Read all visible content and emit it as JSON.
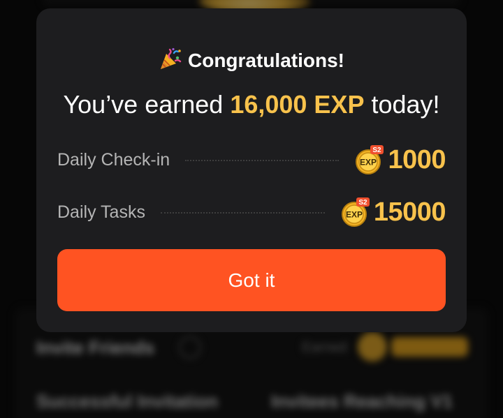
{
  "modal": {
    "title": "Congratulations!",
    "title_icon": "party-popper-icon",
    "earned_prefix": "You’ve earned ",
    "earned_amount": "16,000 EXP",
    "earned_suffix": " today!",
    "rows": [
      {
        "label": "Daily Check-in",
        "badge": {
          "text": "EXP",
          "season": "S2"
        },
        "value": "1000"
      },
      {
        "label": "Daily Tasks",
        "badge": {
          "text": "EXP",
          "season": "S2"
        },
        "value": "15000"
      }
    ],
    "button_label": "Got it"
  },
  "background": {
    "section_title": "Invite Friends",
    "earned_label": "Earned",
    "stat1_label": "Successful Invitation",
    "stat2_label": "Invitees Reaching V1"
  },
  "colors": {
    "modal_bg": "#1d1d1f",
    "accent_gold": "#f8c24c",
    "button": "#ff5322",
    "label_gray": "#b5b5b5"
  }
}
